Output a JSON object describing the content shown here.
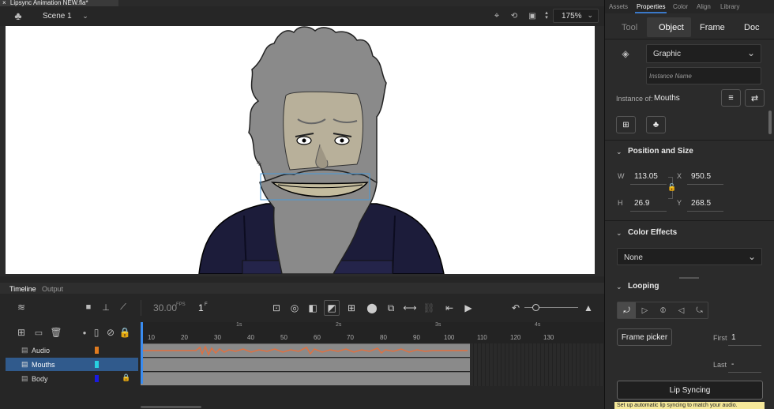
{
  "document": {
    "tab_title": "Lipsync Animation NEW.fla*",
    "close": "×"
  },
  "editbar": {
    "scene": "Scene 1",
    "zoom": "175%"
  },
  "timeline": {
    "tabs": [
      "Timeline",
      "Output"
    ],
    "fps": "30.00",
    "fps_unit": "FPS",
    "frame": "1",
    "frame_unit": "F",
    "seconds": [
      "1s",
      "2s",
      "3s",
      "4s"
    ],
    "frame_numbers": [
      "10",
      "20",
      "30",
      "40",
      "50",
      "60",
      "70",
      "80",
      "90",
      "100",
      "110",
      "120",
      "130"
    ],
    "layers": [
      {
        "name": "Audio",
        "color": "#e07b20",
        "selected": false,
        "locked": false
      },
      {
        "name": "Mouths",
        "color": "#28d0e0",
        "selected": true,
        "locked": false
      },
      {
        "name": "Body",
        "color": "#1a1ae0",
        "selected": false,
        "locked": true
      }
    ]
  },
  "panel": {
    "tabs": [
      "Assets",
      "Properties",
      "Color",
      "Align",
      "Library"
    ],
    "active_tab": "Properties",
    "subtabs": [
      "Tool",
      "Object",
      "Frame",
      "Doc"
    ],
    "active_subtab": "Object",
    "symbol_type": "Graphic",
    "instance_name_placeholder": "Instance Name",
    "instance_of_label": "Instance of:",
    "instance_of_value": "Mouths",
    "position_size": {
      "title": "Position and Size",
      "w_label": "W",
      "w": "113.05",
      "h_label": "H",
      "h": "26.9",
      "x_label": "X",
      "x": "950.5",
      "y_label": "Y",
      "y": "268.5"
    },
    "color_effects": {
      "title": "Color Effects",
      "value": "None"
    },
    "looping": {
      "title": "Looping",
      "frame_picker": "Frame picker",
      "first_label": "First",
      "first": "1",
      "last_label": "Last",
      "last": "-"
    },
    "lip_syncing": "Lip Syncing",
    "tooltip": "Set up automatic lip syncing to match your audio."
  },
  "colors": {
    "accent_blue": "#3a78c8",
    "selected_layer": "#305a8c",
    "playhead": "#3a8cf0",
    "audio_wave": "#e07040"
  }
}
